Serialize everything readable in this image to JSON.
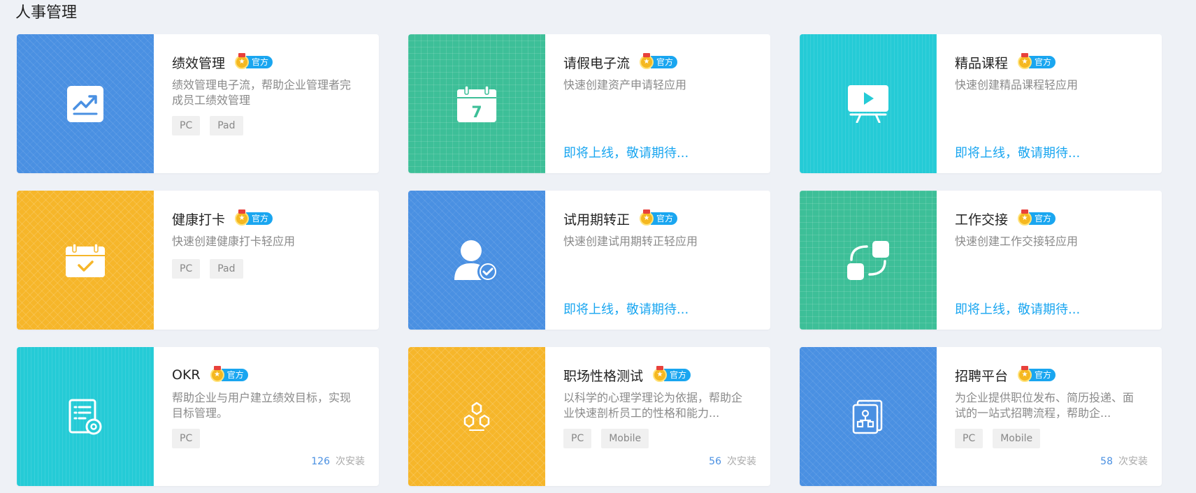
{
  "page_title": "人事管理",
  "official_tag": "官方",
  "coming_soon": "即将上线，敬请期待...",
  "install_suffix": "次安装",
  "cards": [
    {
      "title": "绩效管理",
      "desc": "绩效管理电子流，帮助企业管理者完成员工绩效管理",
      "platforms": [
        "PC",
        "Pad"
      ],
      "icon": "chart-icon",
      "color": "#4a90e2"
    },
    {
      "title": "请假电子流",
      "desc": "快速创建资产申请轻应用",
      "icon": "calendar-icon",
      "color": "#3dbf98"
    },
    {
      "title": "精品课程",
      "desc": "快速创建精品课程轻应用",
      "icon": "presentation-icon",
      "color": "#25cbd6"
    },
    {
      "title": "健康打卡",
      "desc": "快速创建健康打卡轻应用",
      "platforms": [
        "PC",
        "Pad"
      ],
      "icon": "calendar-check-icon",
      "color": "#f6b62a"
    },
    {
      "title": "试用期转正",
      "desc": "快速创建试用期转正轻应用",
      "icon": "user-check-icon",
      "color": "#4a90e2"
    },
    {
      "title": "工作交接",
      "desc": "快速创建工作交接轻应用",
      "icon": "handover-icon",
      "color": "#3dbf98"
    },
    {
      "title": "OKR",
      "desc": "帮助企业与用户建立绩效目标，实现目标管理。",
      "platforms": [
        "PC"
      ],
      "installs": "126",
      "icon": "document-gear-icon",
      "color": "#25cbd6"
    },
    {
      "title": "职场性格测试",
      "desc": "以科学的心理学理论为依据，帮助企业快速剖析员工的性格和能力...",
      "platforms": [
        "PC",
        "Mobile"
      ],
      "installs": "56",
      "icon": "hexagon-icon",
      "color": "#f6b62a"
    },
    {
      "title": "招聘平台",
      "desc": "为企业提供职位发布、简历投递、面试的一站式招聘流程，帮助企...",
      "platforms": [
        "PC",
        "Mobile"
      ],
      "installs": "58",
      "icon": "org-chart-icon",
      "color": "#4a90e2"
    }
  ]
}
